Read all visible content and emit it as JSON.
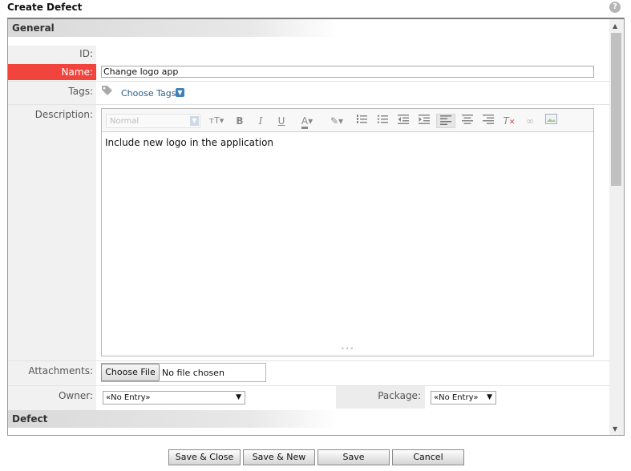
{
  "dialog": {
    "title": "Create Defect",
    "help_icon": "?"
  },
  "sections": {
    "general": "General",
    "defect": "Defect"
  },
  "fields": {
    "id_label": "ID:",
    "name_label": "Name:",
    "name_value": "Change logo app",
    "tags_label": "Tags:",
    "choose_tags": "Choose Tags",
    "description_label": "Description:",
    "attachments_label": "Attachments:",
    "owner_label": "Owner:",
    "package_label": "Package:"
  },
  "editor": {
    "format_value": "Normal",
    "body_text": "Include new logo in the application",
    "toolbar": {
      "font_size": "ᴛT",
      "bold": "B",
      "italic": "I",
      "underline": "U",
      "text_color": "A"
    },
    "icons": [
      "font-size-icon",
      "bold-icon",
      "italic-icon",
      "underline-icon",
      "text-color-icon",
      "highlight-icon",
      "numbered-list-icon",
      "bulleted-list-icon",
      "outdent-icon",
      "indent-icon",
      "align-left-icon",
      "align-center-icon",
      "align-right-icon",
      "clear-format-icon",
      "link-icon",
      "image-icon"
    ]
  },
  "attachments": {
    "button": "Choose File",
    "status": "No file chosen"
  },
  "owner": {
    "value": "«No Entry»"
  },
  "package": {
    "value": "«No Entry»"
  },
  "buttons": {
    "save_close": "Save & Close",
    "save_new": "Save & New",
    "save": "Save",
    "cancel": "Cancel"
  },
  "colors": {
    "name_highlight": "#f0443c",
    "link": "#2c5e8e"
  }
}
